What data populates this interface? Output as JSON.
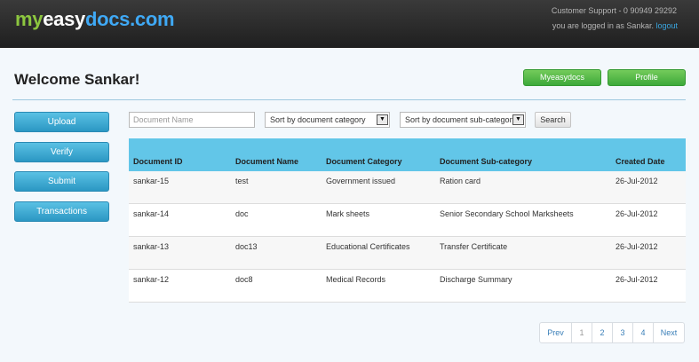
{
  "header": {
    "logo_part1": "my",
    "logo_part2": "easy",
    "logo_part3": "docs.com",
    "support": "Customer Support - 0 90949 29292",
    "logged_in_text": "you are logged in as Sankar.",
    "logout": "logout"
  },
  "welcome": "Welcome Sankar!",
  "top_buttons": {
    "myeasydocs": "Myeasydocs",
    "profile": "Profile"
  },
  "sidebar": {
    "upload": "Upload",
    "verify": "Verify",
    "submit": "Submit",
    "transactions": "Transactions"
  },
  "filters": {
    "doc_name_placeholder": "Document Name",
    "category": "Sort by document category",
    "subcategory": "Sort by document sub-category",
    "search": "Search"
  },
  "table": {
    "columns": [
      "Document ID",
      "Document Name",
      "Document Category",
      "Document Sub-category",
      "Created Date"
    ],
    "rows": [
      [
        "sankar-15",
        "test",
        "Government issued",
        "Ration card",
        "26-Jul-2012"
      ],
      [
        "sankar-14",
        "doc",
        "Mark sheets",
        "Senior Secondary School Marksheets",
        "26-Jul-2012"
      ],
      [
        "sankar-13",
        "doc13",
        "Educational Certificates",
        "Transfer Certificate",
        "26-Jul-2012"
      ],
      [
        "sankar-12",
        "doc8",
        "Medical Records",
        "Discharge Summary",
        "26-Jul-2012"
      ]
    ]
  },
  "pagination": {
    "prev": "Prev",
    "pages": [
      "1",
      "2",
      "3",
      "4"
    ],
    "next": "Next"
  },
  "colors": {
    "brand_green": "#8cc63f",
    "brand_blue": "#3fa9f5",
    "table_header": "#62c6e8",
    "sidebar_button": "#2b97c3"
  }
}
